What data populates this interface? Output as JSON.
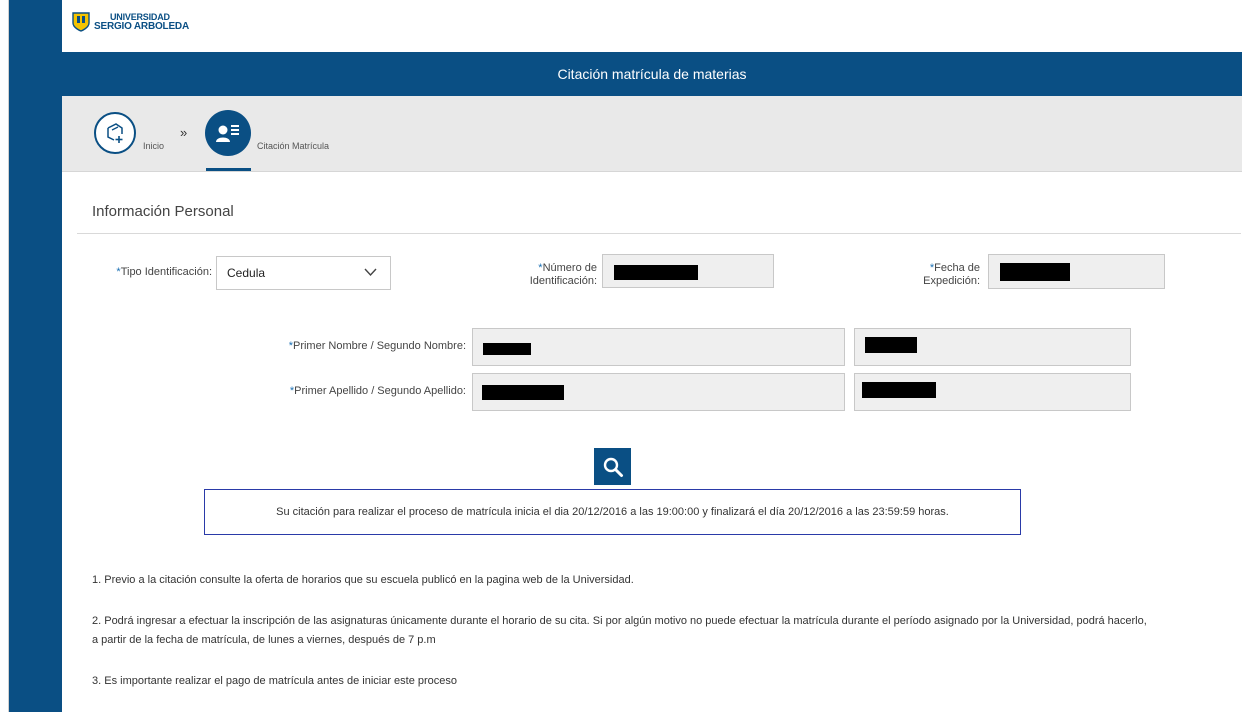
{
  "brand": {
    "line1": "UNIVERSIDAD",
    "line2": "SERGIO ARBOLEDA",
    "shield_colors": [
      "#f4c300",
      "#0a4f84"
    ]
  },
  "header": {
    "title": "Citación matrícula de materias"
  },
  "breadcrumb": {
    "home_label": "Inicio",
    "separator": "»",
    "active_label": "Citación Matrícula",
    "home_icon": "add-document-icon",
    "active_icon": "user-list-icon"
  },
  "section": {
    "title": "Información Personal"
  },
  "form": {
    "required_mark": "*",
    "tipo_label": "Tipo Identificación:",
    "tipo_value": "Cedula",
    "numero_label_1": "Número de",
    "numero_label_2": "Identificación:",
    "fecha_label_1": "Fecha de",
    "fecha_label_2": "Expedición:",
    "nombre_label": "Primer Nombre / Segundo Nombre:",
    "apellido_label": "Primer Apellido / Segundo Apellido:"
  },
  "search": {
    "icon": "search-icon"
  },
  "notice": {
    "text": "Su citación para realizar el proceso de matrícula inicia el dia 20/12/2016 a las 19:00:00 y finalizará el día 20/12/2016 a las 23:59:59 horas."
  },
  "notes": {
    "n1": "1. Previo a la citación consulte la oferta de horarios que su escuela publicó en la pagina web de la Universidad.",
    "n2": "2. Podrá ingresar a efectuar la inscripción de las asignaturas únicamente durante el horario de su cita. Si por algún motivo no puede efectuar la matrícula durante el período asignado por la Universidad, podrá hacerlo, a partir de la fecha de matrícula, de lunes a viernes, después de 7 p.m",
    "n3": "3. Es importante realizar el pago de matrícula antes de iniciar este proceso"
  },
  "colors": {
    "primary": "#0a4f84",
    "notice_border": "#2a3aa8",
    "required": "#1a6fb3"
  }
}
